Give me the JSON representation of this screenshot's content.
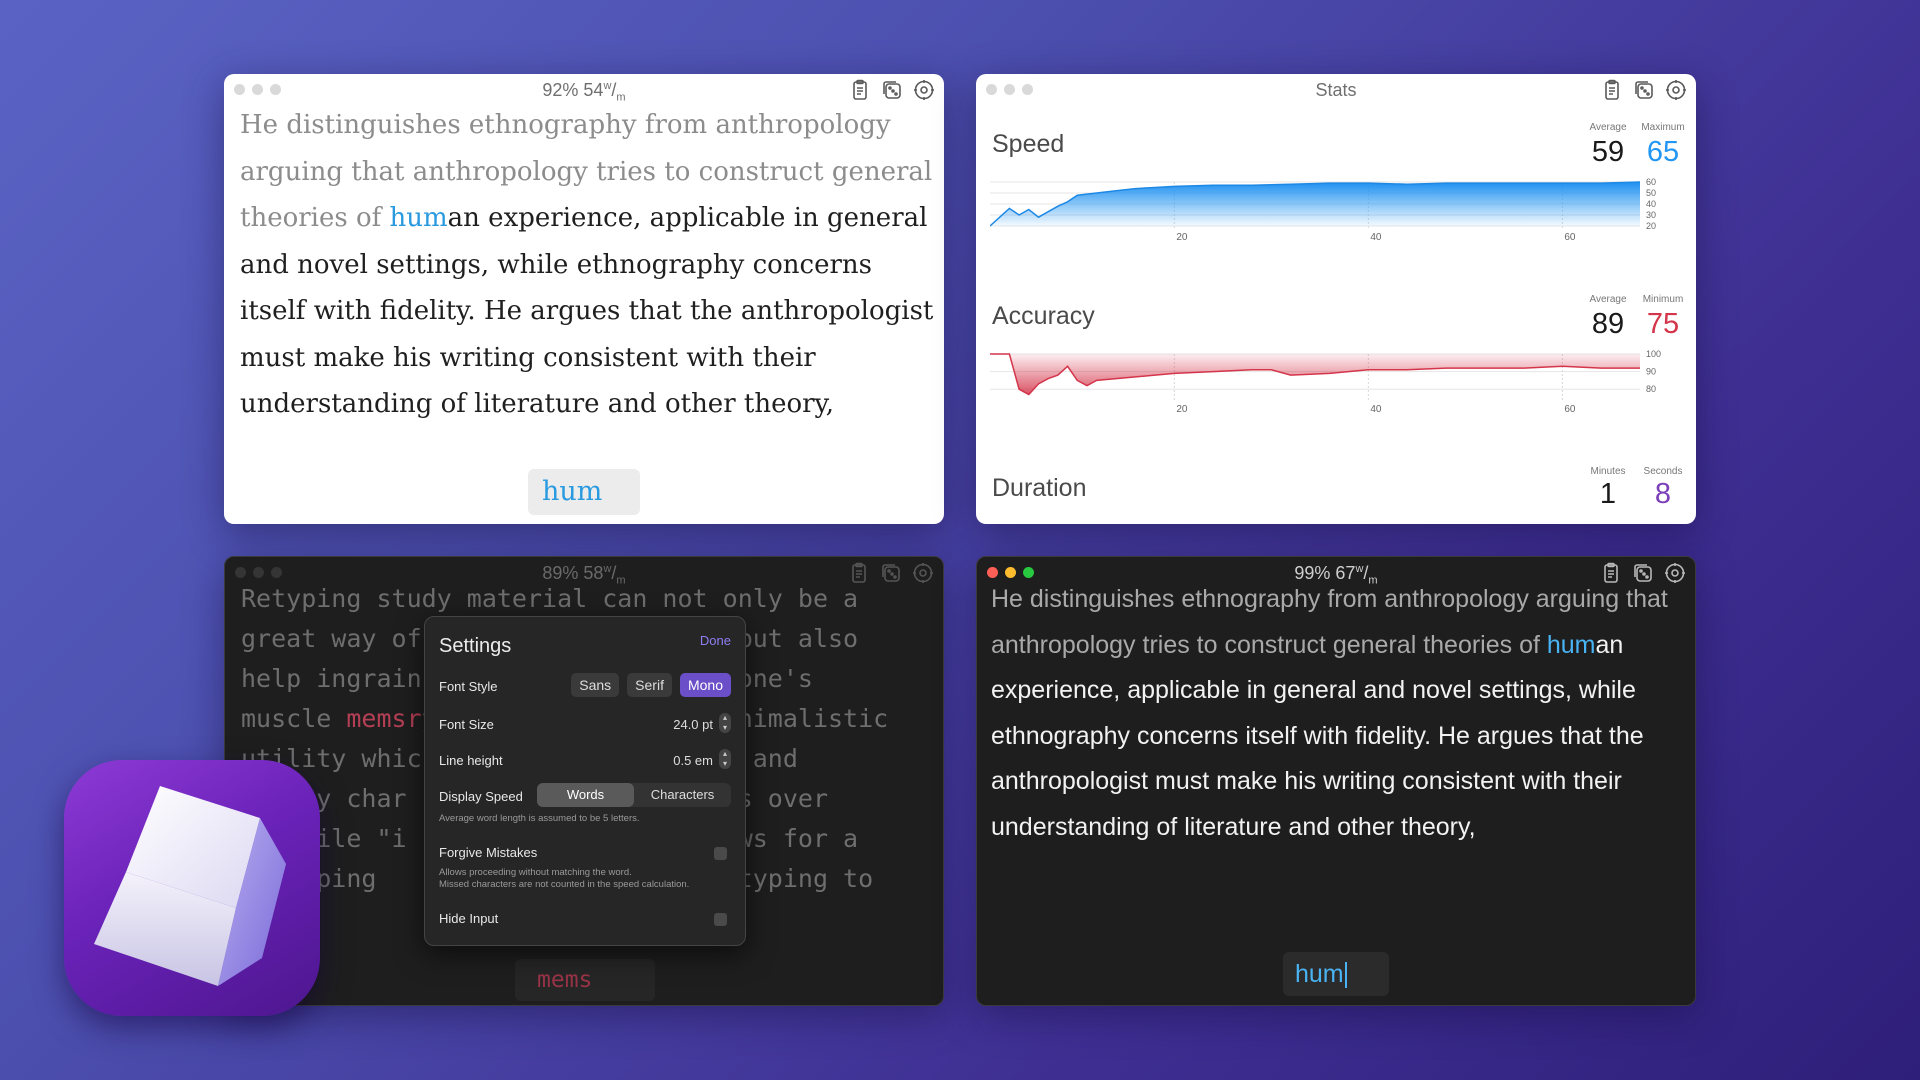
{
  "window1": {
    "title": "92% 54",
    "title_unit_w": "w",
    "title_unit_m": "m",
    "text_typed": "He distinguishes ethnography from anthropology arguing that anthropology tries to construct general theories of ",
    "text_current_typed": "hum",
    "text_rest": "an experience, applicable in general and novel settings, while ethnography concerns itself with fidelity. He argues that the anthropologist must make his writing consistent with their understanding of literature and other theory,",
    "input_value": "hum"
  },
  "stats": {
    "title": "Stats",
    "speed": {
      "label": "Speed",
      "average_label": "Average",
      "maximum_label": "Maximum",
      "average": "59",
      "maximum": "65"
    },
    "accuracy": {
      "label": "Accuracy",
      "average_label": "Average",
      "minimum_label": "Minimum",
      "average": "89",
      "minimum": "75"
    },
    "duration": {
      "label": "Duration",
      "minutes_label": "Minutes",
      "seconds_label": "Seconds",
      "minutes": "1",
      "seconds": "8"
    },
    "colors": {
      "speed": "#2196f3",
      "accuracy": "#d4354a",
      "seconds": "#7b3fb8"
    }
  },
  "chart_data": [
    {
      "type": "area",
      "title": "Speed",
      "x_ticks": [
        "20",
        "40",
        "60"
      ],
      "y_ticks": [
        "60",
        "50",
        "40",
        "30",
        "20"
      ],
      "x": [
        1,
        2,
        3,
        4,
        5,
        6,
        7,
        8,
        9,
        10,
        12,
        14,
        16,
        18,
        20,
        24,
        28,
        32,
        36,
        40,
        44,
        48,
        52,
        56,
        60,
        64,
        68
      ],
      "y": [
        20,
        28,
        36,
        30,
        35,
        28,
        33,
        38,
        42,
        48,
        50,
        52,
        54,
        55,
        56,
        57,
        57,
        58,
        59,
        59,
        58,
        59,
        59,
        59,
        59,
        59,
        60
      ],
      "ylim": [
        20,
        60
      ]
    },
    {
      "type": "area",
      "title": "Accuracy",
      "x_ticks": [
        "20",
        "40",
        "60"
      ],
      "y_ticks": [
        "100",
        "90",
        "80"
      ],
      "x": [
        1,
        2,
        3,
        4,
        5,
        6,
        7,
        8,
        9,
        10,
        11,
        12,
        14,
        16,
        18,
        20,
        24,
        28,
        30,
        32,
        36,
        40,
        44,
        48,
        52,
        56,
        60,
        64,
        68
      ],
      "y": [
        100,
        100,
        100,
        80,
        77,
        83,
        86,
        88,
        93,
        85,
        82,
        85,
        86,
        87,
        88,
        89,
        90,
        91,
        91,
        88,
        89,
        91,
        91,
        92,
        92,
        92,
        93,
        92,
        92
      ],
      "ylim": [
        75,
        100
      ]
    }
  ],
  "window3": {
    "title": "89% 58",
    "title_unit_w": "w",
    "title_unit_m": "m",
    "lines": [
      "Retyping study material can not only be a",
      "great way of                  t, but also",
      "help ingrain                  in one's",
      "muscle ",
      "utility which                 eed and",
      "   acy char                   ress over",
      "   while \"i                   llows for a",
      "   typing                     by typing to"
    ],
    "wrong_word": "memsr",
    "line4_rest": "y                  minimalistic",
    "input_value": "mems",
    "settings": {
      "title": "Settings",
      "done": "Done",
      "font_style_label": "Font Style",
      "font_styles": [
        "Sans",
        "Serif",
        "Mono"
      ],
      "font_size_label": "Font Size",
      "font_size_value": "24.0 pt",
      "line_height_label": "Line height",
      "line_height_value": "0.5 em",
      "display_speed_label": "Display Speed",
      "display_speed_options": [
        "Words",
        "Characters"
      ],
      "display_speed_note": "Average word length is assumed to be 5 letters.",
      "forgive_label": "Forgive Mistakes",
      "forgive_note_1": "Allows proceeding without matching the word.",
      "forgive_note_2": "Missed characters are not counted in the speed calculation.",
      "hide_input_label": "Hide Input"
    }
  },
  "window4": {
    "title": "99% 67",
    "title_unit_w": "w",
    "title_unit_m": "m",
    "text_typed": "He distinguishes ethnography from anthropology arguing that anthropology tries to construct general theories of ",
    "text_current_typed": "hum",
    "text_rest": "an experience, applicable in general and novel settings, while ethnography concerns itself with fidelity. He argues that the anthropologist must make his writing consistent with their understanding of literature and other theory,",
    "input_value": "hum"
  }
}
